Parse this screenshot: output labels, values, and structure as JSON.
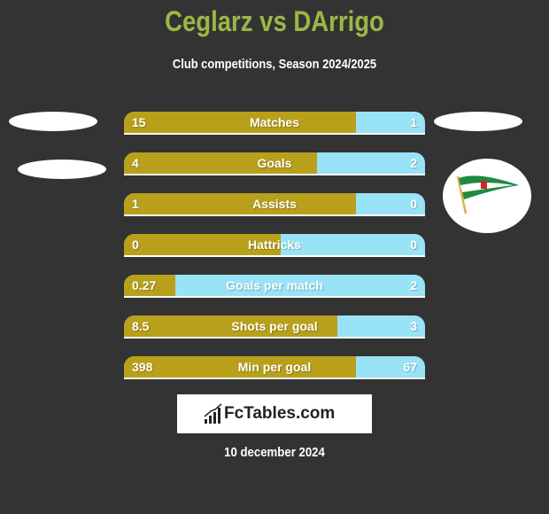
{
  "header": {
    "title": "Ceglarz vs DArrigo",
    "subtitle": "Club competitions, Season 2024/2025"
  },
  "colors": {
    "title": "#9ab845",
    "left_bar": "#b8a01a",
    "right_bar": "#99e3f6",
    "background": "#333333"
  },
  "stats": [
    {
      "label": "Matches",
      "left": "15",
      "right": "1",
      "left_share": 0.77
    },
    {
      "label": "Goals",
      "left": "4",
      "right": "2",
      "left_share": 0.64
    },
    {
      "label": "Assists",
      "left": "1",
      "right": "0",
      "left_share": 0.77
    },
    {
      "label": "Hattricks",
      "left": "0",
      "right": "0",
      "left_share": 0.52
    },
    {
      "label": "Goals per match",
      "left": "0.27",
      "right": "2",
      "left_share": 0.17
    },
    {
      "label": "Shots per goal",
      "left": "8.5",
      "right": "3",
      "left_share": 0.71
    },
    {
      "label": "Min per goal",
      "left": "398",
      "right": "67",
      "left_share": 0.77
    }
  ],
  "right_team_logo": "green-white-pennant-flag-icon",
  "brand": {
    "name": "FcTables.com",
    "icon": "bar-chart-icon"
  },
  "date": "10 december 2024"
}
